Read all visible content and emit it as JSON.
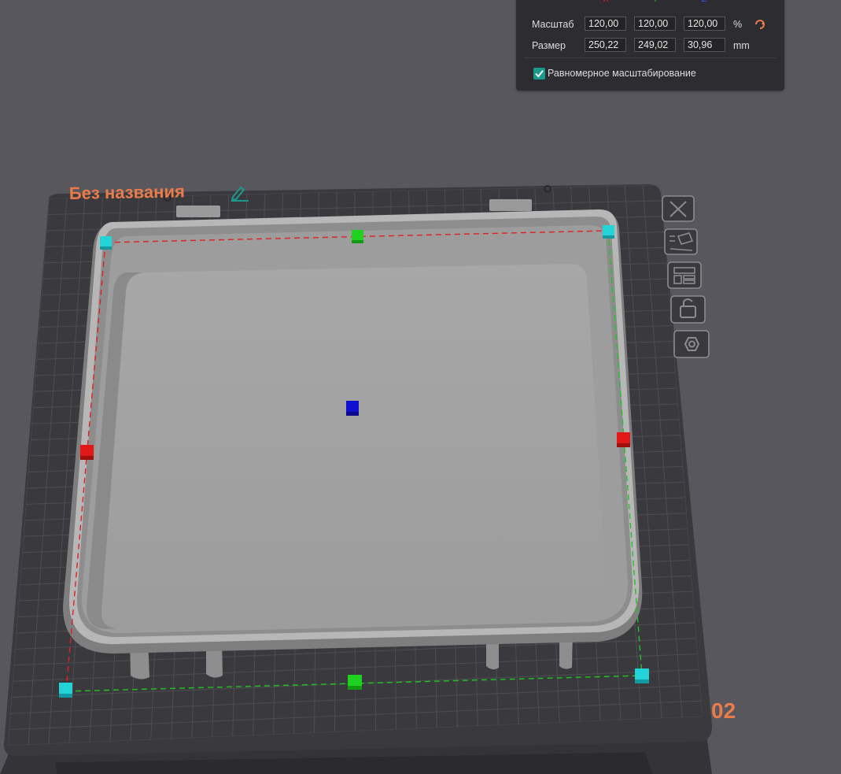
{
  "plate": {
    "name": "Без названия",
    "number": "02"
  },
  "scale_panel": {
    "axes": [
      "X",
      "Y",
      "Z"
    ],
    "scale_label": "Масштаб",
    "scale_values": [
      "120,00",
      "120,00",
      "120,00"
    ],
    "scale_unit": "%",
    "size_label": "Размер",
    "size_values": [
      "250,22",
      "249,02",
      "30,96"
    ],
    "size_unit": "mm",
    "uniform_label": "Равномерное масштабирование",
    "uniform_checked": true
  },
  "plate_tools": [
    "close-icon",
    "auto-orient-icon",
    "arrange-icon",
    "lock-icon",
    "settings-icon"
  ],
  "colors": {
    "background": "#57575d",
    "plate": "#3b3b3f",
    "grid": "#4e4e53",
    "accent_orange": "#ea7b4b",
    "accent_teal": "#1a9a8a",
    "handle_cyan": "#22d3d8",
    "handle_green": "#1fd21f",
    "handle_red": "#e01818",
    "handle_blue": "#1010d0",
    "axis_x": "#e02020",
    "axis_y": "#22c422",
    "axis_z": "#2a5bff"
  }
}
